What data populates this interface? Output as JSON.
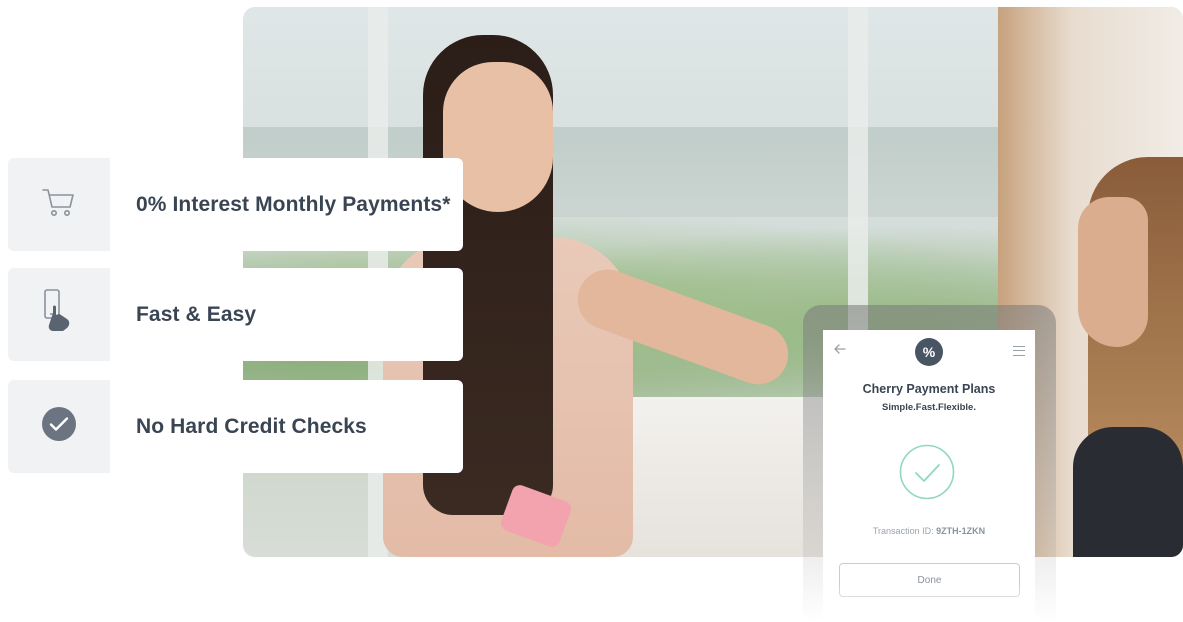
{
  "features": [
    {
      "icon": "shopping-cart-icon",
      "label": "0% Interest Monthly Payments*"
    },
    {
      "icon": "phone-tap-icon",
      "label": "Fast & Easy"
    },
    {
      "icon": "check-circle-icon",
      "label": "No Hard Credit Checks"
    }
  ],
  "phone": {
    "logo_symbol": "%",
    "title": "Cherry Payment Plans",
    "subtitle": "Simple.Fast.Flexible.",
    "transaction_label": "Transaction ID: ",
    "transaction_id": "9ZTH-1ZKN",
    "done_label": "Done"
  },
  "colors": {
    "text_dark": "#3a4553",
    "icon_box_bg": "#f1f2f3",
    "success_green": "#8fd8c3",
    "logo_bg": "#4a5563"
  }
}
